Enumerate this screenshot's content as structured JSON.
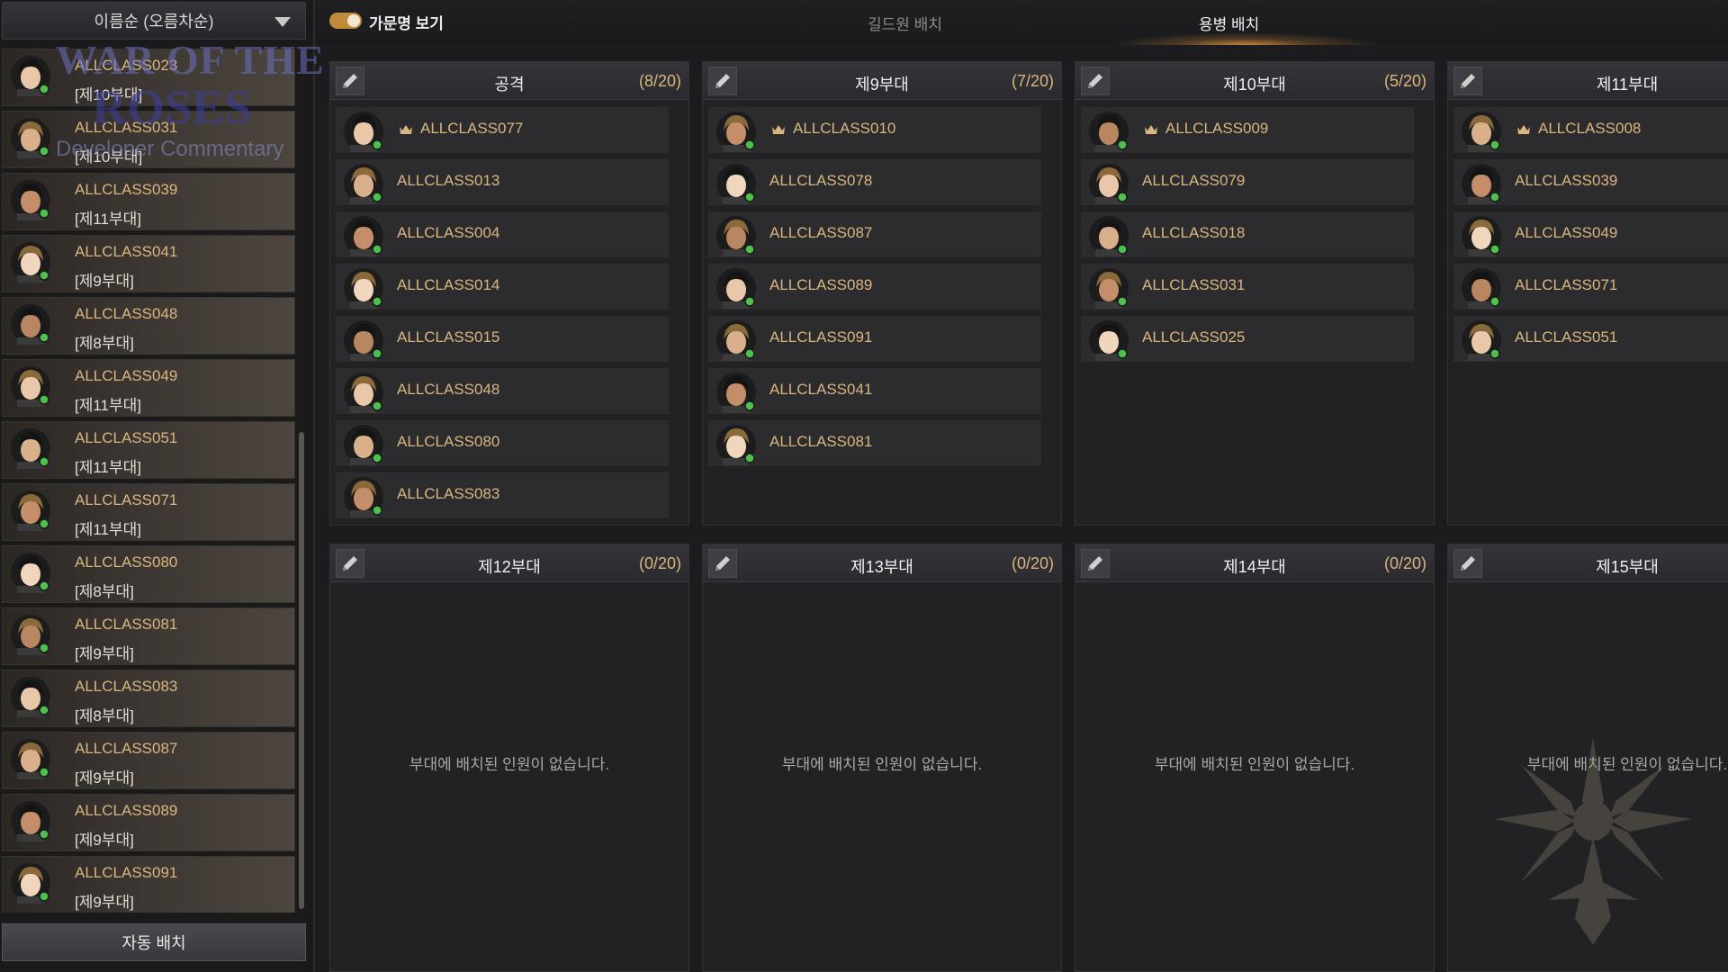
{
  "sidebar": {
    "sort_label": "이름순 (오름차순)",
    "auto_assign_label": "자동 배치",
    "watermark": {
      "line1": "WAR OF THE",
      "line2": "ROSES",
      "line3": "Developer Commentary"
    },
    "members": [
      {
        "name": "ALLCLASS023",
        "group": "[제10부대]"
      },
      {
        "name": "ALLCLASS031",
        "group": "[제10부대]"
      },
      {
        "name": "ALLCLASS039",
        "group": "[제11부대]"
      },
      {
        "name": "ALLCLASS041",
        "group": "[제9부대]"
      },
      {
        "name": "ALLCLASS048",
        "group": "[제8부대]"
      },
      {
        "name": "ALLCLASS049",
        "group": "[제11부대]"
      },
      {
        "name": "ALLCLASS051",
        "group": "[제11부대]"
      },
      {
        "name": "ALLCLASS071",
        "group": "[제11부대]"
      },
      {
        "name": "ALLCLASS080",
        "group": "[제8부대]"
      },
      {
        "name": "ALLCLASS081",
        "group": "[제9부대]"
      },
      {
        "name": "ALLCLASS083",
        "group": "[제8부대]"
      },
      {
        "name": "ALLCLASS087",
        "group": "[제9부대]"
      },
      {
        "name": "ALLCLASS089",
        "group": "[제9부대]"
      },
      {
        "name": "ALLCLASS091",
        "group": "[제9부대]"
      }
    ]
  },
  "topbar": {
    "toggle_label": "가문명 보기",
    "tab_guild": "길드원 배치",
    "tab_merc": "용병 배치"
  },
  "colors": {
    "accent": "#d9b67e",
    "online": "#4cc24c",
    "tab_glow": "#e0963c"
  },
  "squads": [
    {
      "title": "공격",
      "count": "(8/20)",
      "empty_text": "",
      "members": [
        "ALLCLASS077",
        "ALLCLASS013",
        "ALLCLASS004",
        "ALLCLASS014",
        "ALLCLASS015",
        "ALLCLASS048",
        "ALLCLASS080",
        "ALLCLASS083"
      ]
    },
    {
      "title": "제9부대",
      "count": "(7/20)",
      "empty_text": "",
      "members": [
        "ALLCLASS010",
        "ALLCLASS078",
        "ALLCLASS087",
        "ALLCLASS089",
        "ALLCLASS091",
        "ALLCLASS041",
        "ALLCLASS081"
      ]
    },
    {
      "title": "제10부대",
      "count": "(5/20)",
      "empty_text": "",
      "members": [
        "ALLCLASS009",
        "ALLCLASS079",
        "ALLCLASS018",
        "ALLCLASS031",
        "ALLCLASS025"
      ]
    },
    {
      "title": "제11부대",
      "count": "",
      "empty_text": "",
      "members": [
        "ALLCLASS008",
        "ALLCLASS039",
        "ALLCLASS049",
        "ALLCLASS071",
        "ALLCLASS051"
      ]
    },
    {
      "title": "제12부대",
      "count": "(0/20)",
      "empty_text": "부대에 배치된 인원이 없습니다.",
      "members": []
    },
    {
      "title": "제13부대",
      "count": "(0/20)",
      "empty_text": "부대에 배치된 인원이 없습니다.",
      "members": []
    },
    {
      "title": "제14부대",
      "count": "(0/20)",
      "empty_text": "부대에 배치된 인원이 없습니다.",
      "members": []
    },
    {
      "title": "제15부대",
      "count": "",
      "empty_text": "부대에 배치된 인원이 없습니다.",
      "members": []
    }
  ]
}
